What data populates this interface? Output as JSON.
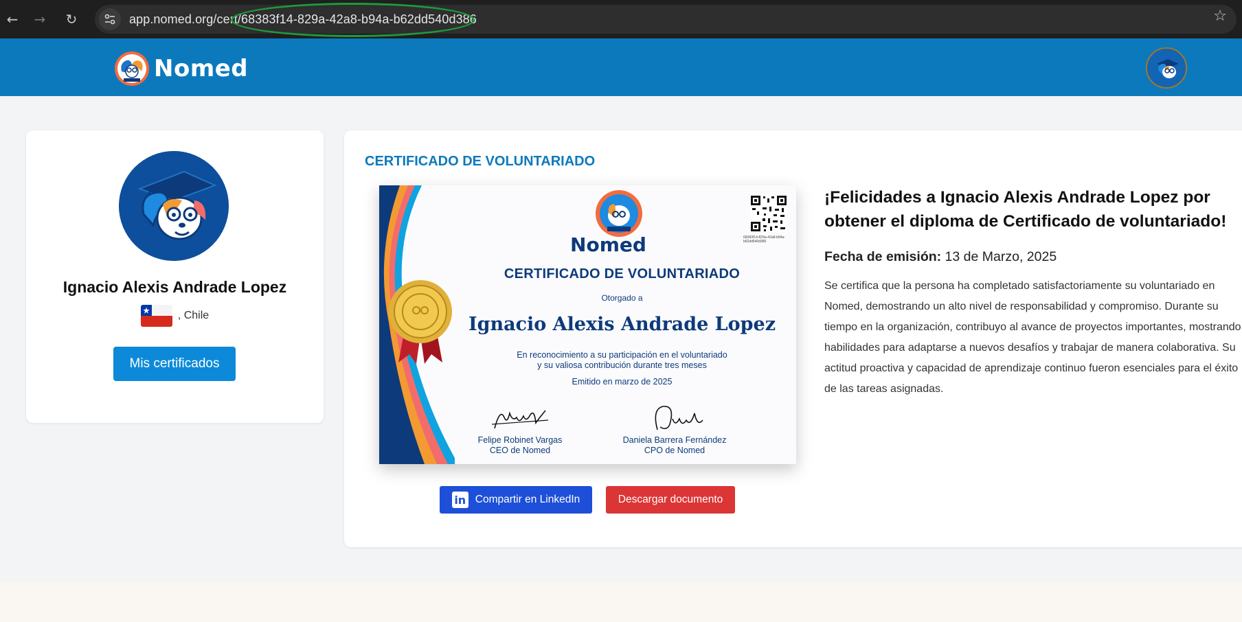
{
  "browser": {
    "url": "app.nomed.org/cert/68383f14-829a-42a8-b94a-b62dd540d386",
    "icons": [
      "back-arrow-icon",
      "forward-arrow-icon",
      "reload-icon",
      "site-settings-icon",
      "star-icon"
    ]
  },
  "header": {
    "brand": "Nomed"
  },
  "profile": {
    "name": "Ignacio Alexis Andrade Lopez",
    "location": ", Chile",
    "button": "Mis certificados"
  },
  "certificate": {
    "section_title": "CERTIFICADO DE VOLUNTARIADO",
    "image": {
      "brand": "Nomed",
      "qr_id": "68383f14-829a-42a8-b94a-b62dd540d386",
      "title": "CERTIFICADO DE VOLUNTARIADO",
      "otorgado": "Otorgado a",
      "recipient": "Ignacio Alexis Andrade Lopez",
      "desc_line1": "En reconocimiento a su participación en el voluntariado",
      "desc_line2": "y su valiosa contribución durante tres meses",
      "emitido": "Emitido en marzo de 2025",
      "signer1_name": "Felipe Robinet Vargas",
      "signer1_role": "CEO de Nomed",
      "signer2_name": "Daniela Barrera Fernández",
      "signer2_role": "CPO de Nomed"
    },
    "linkedin_button": "Compartir en LinkedIn",
    "download_button": "Descargar documento",
    "congrats": "¡Felicidades a Ignacio Alexis Andrade Lopez por obtener el diploma de Certificado de voluntariado!",
    "fecha_label": "Fecha de emisión:",
    "fecha_value": " 13 de Marzo, 2025",
    "description": "Se certifica que la persona ha completado satisfactoriamente su voluntariado en Nomed, demostrando un alto nivel de responsabilidad y compromiso. Durante su tiempo en la organización, contribuyo al avance de proyectos importantes, mostrando habilidades para adaptarse a nuevos desafíos y trabajar de manera colaborativa. Su actitud proactiva y capacidad de aprendizaje continuo fueron esenciales para el éxito de las tareas asignadas."
  },
  "colors": {
    "header_blue": "#0c79bd",
    "primary_button": "#0c8ad9",
    "linkedin_blue": "#1d4fd8",
    "download_red": "#dc3535",
    "cert_navy": "#0d3a7a",
    "highlight_oval": "#1f9a3a"
  }
}
